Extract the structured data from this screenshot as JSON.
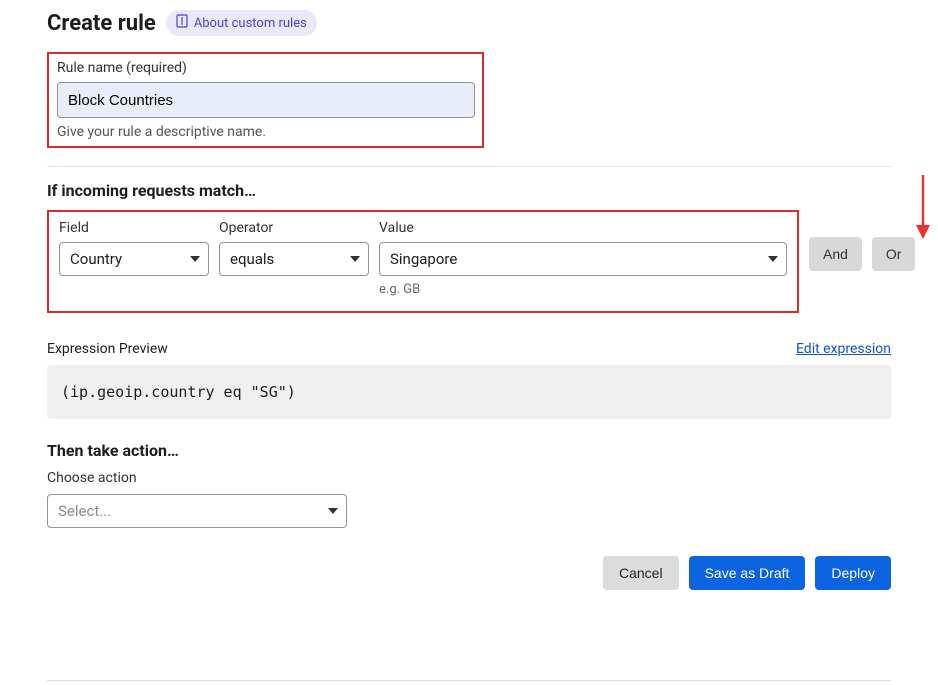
{
  "header": {
    "title": "Create rule",
    "about_label": "About custom rules"
  },
  "rule_name": {
    "label": "Rule name (required)",
    "value": "Block Countries",
    "hint": "Give your rule a descriptive name."
  },
  "match": {
    "heading": "If incoming requests match…",
    "field_label": "Field",
    "operator_label": "Operator",
    "value_label": "Value",
    "field_selected": "Country",
    "operator_selected": "equals",
    "value_selected": "Singapore",
    "value_hint": "e.g. GB",
    "and_label": "And",
    "or_label": "Or"
  },
  "preview": {
    "label": "Expression Preview",
    "edit_label": "Edit expression",
    "code": "(ip.geoip.country eq \"SG\")"
  },
  "action": {
    "heading": "Then take action…",
    "choose_label": "Choose action",
    "placeholder": "Select..."
  },
  "footer": {
    "cancel": "Cancel",
    "draft": "Save as Draft",
    "deploy": "Deploy"
  }
}
